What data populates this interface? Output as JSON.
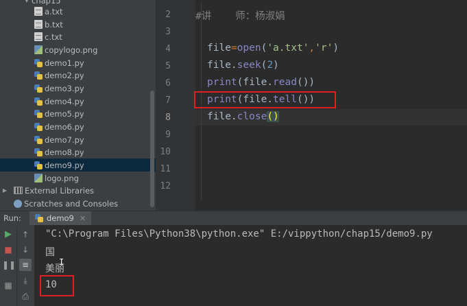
{
  "project_tree": {
    "folder_label": "chap15",
    "items": [
      {
        "label": "a.txt",
        "kind": "txt"
      },
      {
        "label": "b.txt",
        "kind": "txt"
      },
      {
        "label": "c.txt",
        "kind": "txt"
      },
      {
        "label": "copylogo.png",
        "kind": "png"
      },
      {
        "label": "demo1.py",
        "kind": "py"
      },
      {
        "label": "demo2.py",
        "kind": "py"
      },
      {
        "label": "demo3.py",
        "kind": "py"
      },
      {
        "label": "demo4.py",
        "kind": "py"
      },
      {
        "label": "demo5.py",
        "kind": "py"
      },
      {
        "label": "demo6.py",
        "kind": "py"
      },
      {
        "label": "demo7.py",
        "kind": "py"
      },
      {
        "label": "demo8.py",
        "kind": "py"
      },
      {
        "label": "demo9.py",
        "kind": "py",
        "selected": true
      },
      {
        "label": "logo.png",
        "kind": "png"
      }
    ],
    "external_libraries": "External Libraries",
    "scratches": "Scratches and Consoles"
  },
  "editor": {
    "line_numbers": [
      "2",
      "3",
      "4",
      "5",
      "6",
      "7",
      "8",
      "9",
      "10",
      "11",
      "12"
    ],
    "active_line": "8",
    "comment_line": "#讲    师：杨淑娟",
    "code": {
      "line4": {
        "var": "file",
        "eq": "=",
        "fn": "open",
        "open": "(",
        "arg1": "'a.txt'",
        "comma": ",",
        "arg2": "'r'",
        "close": ")"
      },
      "line5": {
        "obj": "file.",
        "method": "seek",
        "open": "(",
        "num": "2",
        "close": ")"
      },
      "line6": {
        "fn": "print",
        "open": "(",
        "obj": "file.",
        "method": "read",
        "close": "())"
      },
      "line7": {
        "fn": "print",
        "open": "(",
        "obj": "file.",
        "method": "tell",
        "close": "())"
      },
      "line8": {
        "obj": "file.",
        "method": "close",
        "open": "(",
        "close": ")"
      }
    }
  },
  "run_panel": {
    "label": "Run:",
    "tab_label": "demo9",
    "close_glyph": "✕",
    "output_lines": [
      "\"C:\\Program Files\\Python38\\python.exe\" E:/vippython/chap15/demo9.py",
      "国",
      "美丽",
      "10"
    ]
  },
  "colors": {
    "highlight_box": "#e02020",
    "selected_row": "#0d293e",
    "function": "#8888c6",
    "string": "#a6c48a",
    "number": "#6897bb"
  }
}
